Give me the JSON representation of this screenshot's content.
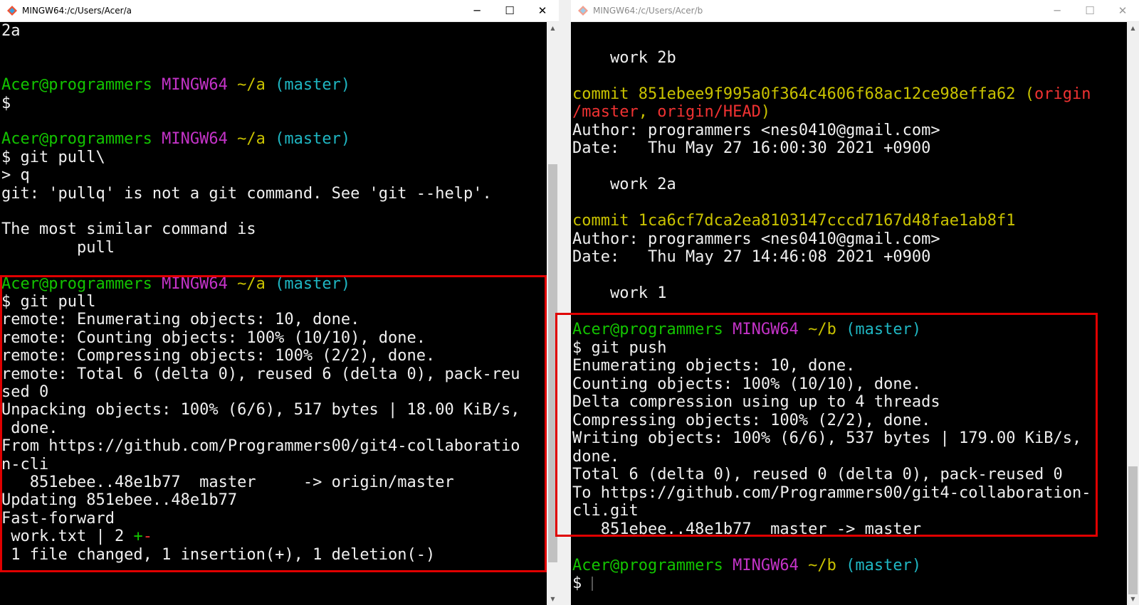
{
  "window_a": {
    "title": "MINGW64:/c/Users/Acer/a",
    "controls": {
      "minimize": "─",
      "maximize": "☐",
      "close": "✕"
    },
    "lines": [
      [
        {
          "t": "2a",
          "c": "w"
        }
      ],
      [],
      [],
      [
        {
          "t": "Acer@programmers ",
          "c": "g"
        },
        {
          "t": "MINGW64 ",
          "c": "m"
        },
        {
          "t": "~/a ",
          "c": "y"
        },
        {
          "t": "(master)",
          "c": "c"
        }
      ],
      [
        {
          "t": "$",
          "c": "w"
        }
      ],
      [],
      [
        {
          "t": "Acer@programmers ",
          "c": "g"
        },
        {
          "t": "MINGW64 ",
          "c": "m"
        },
        {
          "t": "~/a ",
          "c": "y"
        },
        {
          "t": "(master)",
          "c": "c"
        }
      ],
      [
        {
          "t": "$ git pull\\",
          "c": "w"
        }
      ],
      [
        {
          "t": "> q",
          "c": "w"
        }
      ],
      [
        {
          "t": "git: 'pullq' is not a git command. See 'git --help'.",
          "c": "w"
        }
      ],
      [],
      [
        {
          "t": "The most similar command is",
          "c": "w"
        }
      ],
      [
        {
          "t": "        pull",
          "c": "w"
        }
      ],
      [],
      [
        {
          "t": "Acer@programmers ",
          "c": "g"
        },
        {
          "t": "MINGW64 ",
          "c": "m"
        },
        {
          "t": "~/a ",
          "c": "y"
        },
        {
          "t": "(master)",
          "c": "c"
        }
      ],
      [
        {
          "t": "$ git pull",
          "c": "w"
        }
      ],
      [
        {
          "t": "remote: Enumerating objects: 10, done.",
          "c": "w"
        }
      ],
      [
        {
          "t": "remote: Counting objects: 100% (10/10), done.",
          "c": "w"
        }
      ],
      [
        {
          "t": "remote: Compressing objects: 100% (2/2), done.",
          "c": "w"
        }
      ],
      [
        {
          "t": "remote: Total 6 (delta 0), reused 6 (delta 0), pack-reu",
          "c": "w"
        }
      ],
      [
        {
          "t": "sed 0",
          "c": "w"
        }
      ],
      [
        {
          "t": "Unpacking objects: 100% (6/6), 517 bytes | 18.00 KiB/s,",
          "c": "w"
        }
      ],
      [
        {
          "t": " done.",
          "c": "w"
        }
      ],
      [
        {
          "t": "From https://github.com/Programmers00/git4-collaboratio",
          "c": "w"
        }
      ],
      [
        {
          "t": "n-cli",
          "c": "w"
        }
      ],
      [
        {
          "t": "   851ebee..48e1b77  master     -> origin/master",
          "c": "w"
        }
      ],
      [
        {
          "t": "Updating 851ebee..48e1b77",
          "c": "w"
        }
      ],
      [
        {
          "t": "Fast-forward",
          "c": "w"
        }
      ],
      [
        {
          "t": " work.txt | 2 ",
          "c": "w"
        },
        {
          "t": "+",
          "c": "g"
        },
        {
          "t": "-",
          "c": "r"
        }
      ],
      [
        {
          "t": " 1 file changed, 1 insertion(+), 1 deletion(-)",
          "c": "w"
        }
      ]
    ]
  },
  "window_b": {
    "title": "MINGW64:/c/Users/Acer/b",
    "controls": {
      "minimize": "─",
      "maximize": "☐",
      "close": "✕"
    },
    "lines": [
      [],
      [
        {
          "t": "    work 2b",
          "c": "w"
        }
      ],
      [],
      [
        {
          "t": "commit 851ebee9f995a0f364c4606f68ac12ce98effa62 ",
          "c": "y"
        },
        {
          "t": "(",
          "c": "y"
        },
        {
          "t": "origin",
          "c": "r"
        }
      ],
      [
        {
          "t": "/master",
          "c": "r"
        },
        {
          "t": ", ",
          "c": "y"
        },
        {
          "t": "origin/HEAD",
          "c": "r"
        },
        {
          "t": ")",
          "c": "y"
        }
      ],
      [
        {
          "t": "Author: programmers <nes0410@gmail.com>",
          "c": "w"
        }
      ],
      [
        {
          "t": "Date:   Thu May 27 16:00:30 2021 +0900",
          "c": "w"
        }
      ],
      [],
      [
        {
          "t": "    work 2a",
          "c": "w"
        }
      ],
      [],
      [
        {
          "t": "commit 1ca6cf7dca2ea8103147cccd7167d48fae1ab8f1",
          "c": "y"
        }
      ],
      [
        {
          "t": "Author: programmers <nes0410@gmail.com>",
          "c": "w"
        }
      ],
      [
        {
          "t": "Date:   Thu May 27 14:46:08 2021 +0900",
          "c": "w"
        }
      ],
      [],
      [
        {
          "t": "    work 1",
          "c": "w"
        }
      ],
      [],
      [
        {
          "t": "Acer@programmers ",
          "c": "g"
        },
        {
          "t": "MINGW64 ",
          "c": "m"
        },
        {
          "t": "~/b ",
          "c": "y"
        },
        {
          "t": "(master)",
          "c": "c"
        }
      ],
      [
        {
          "t": "$ git push",
          "c": "w"
        }
      ],
      [
        {
          "t": "Enumerating objects: 10, done.",
          "c": "w"
        }
      ],
      [
        {
          "t": "Counting objects: 100% (10/10), done.",
          "c": "w"
        }
      ],
      [
        {
          "t": "Delta compression using up to 4 threads",
          "c": "w"
        }
      ],
      [
        {
          "t": "Compressing objects: 100% (2/2), done.",
          "c": "w"
        }
      ],
      [
        {
          "t": "Writing objects: 100% (6/6), 537 bytes | 179.00 KiB/s,",
          "c": "w"
        }
      ],
      [
        {
          "t": "done.",
          "c": "w"
        }
      ],
      [
        {
          "t": "Total 6 (delta 0), reused 0 (delta 0), pack-reused 0",
          "c": "w"
        }
      ],
      [
        {
          "t": "To https://github.com/Programmers00/git4-collaboration-",
          "c": "w"
        }
      ],
      [
        {
          "t": "cli.git",
          "c": "w"
        }
      ],
      [
        {
          "t": "   851ebee..48e1b77  master -> master",
          "c": "w"
        }
      ],
      [],
      [
        {
          "t": "Acer@programmers ",
          "c": "g"
        },
        {
          "t": "MINGW64 ",
          "c": "m"
        },
        {
          "t": "~/b ",
          "c": "y"
        },
        {
          "t": "(master)",
          "c": "c"
        }
      ],
      [
        {
          "t": "$ ",
          "c": "w"
        }
      ]
    ]
  }
}
